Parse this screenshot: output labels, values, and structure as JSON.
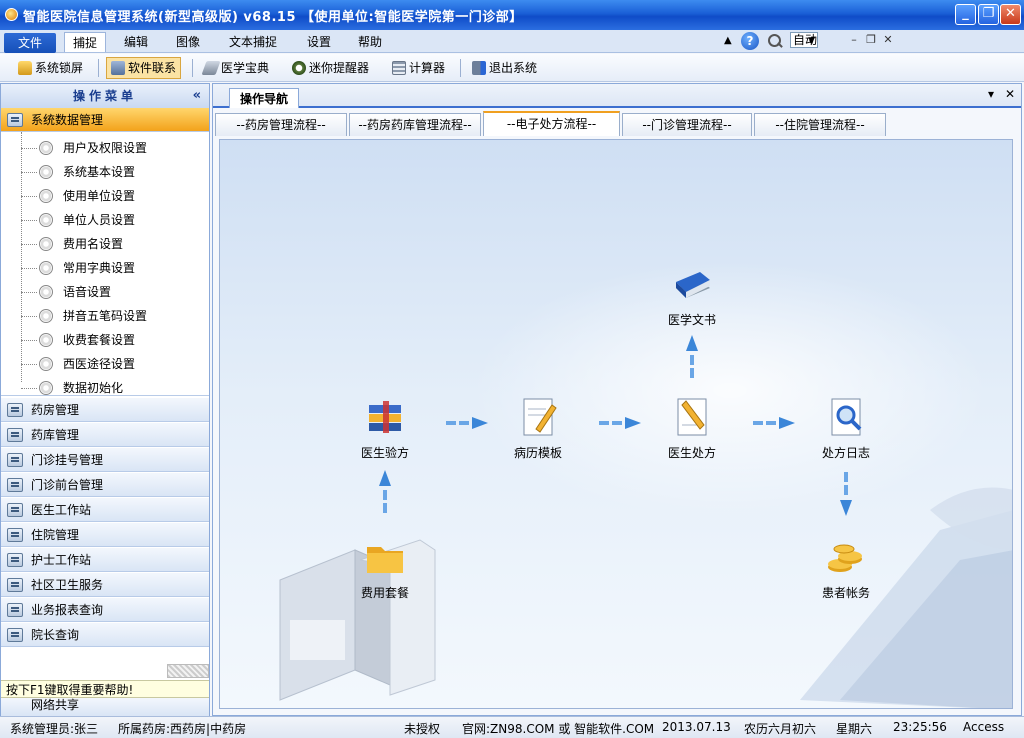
{
  "window": {
    "title": "智能医院信息管理系统(新型高级版) v68.15  【使用单位:智能医学院第一门诊部】"
  },
  "menu": {
    "items": [
      "文件",
      "捕捉",
      "编辑",
      "图像",
      "文本捕捉",
      "设置",
      "帮助"
    ],
    "active": "捕捉",
    "zoom_value": "自动"
  },
  "toolbar": {
    "items": [
      "系统锁屏",
      "软件联系",
      "医学宝典",
      "迷你提醒器",
      "计算器",
      "退出系统"
    ],
    "pressed": "软件联系"
  },
  "sidebar": {
    "title": "操作菜单",
    "expanded_group": "系统数据管理",
    "sub_items": [
      "用户及权限设置",
      "系统基本设置",
      "使用单位设置",
      "单位人员设置",
      "费用名设置",
      "常用字典设置",
      "语音设置",
      "拼音五笔码设置",
      "收费套餐设置",
      "西医途径设置",
      "数据初始化"
    ],
    "groups": [
      "药房管理",
      "药库管理",
      "门诊挂号管理",
      "门诊前台管理",
      "医生工作站",
      "住院管理",
      "护士工作站",
      "社区卫生服务",
      "业务报表查询",
      "院长查询"
    ],
    "hint": "按下F1键取得重要帮助!",
    "last_group": "网络共享"
  },
  "main": {
    "doc_tab": "操作导航",
    "flow_tabs": [
      "--药房管理流程--",
      "--药房药库管理流程--",
      "--电子处方流程--",
      "--门诊管理流程--",
      "--住院管理流程--"
    ],
    "active_flow_tab": "--电子处方流程--",
    "nodes": {
      "medical_book": "医学文书",
      "doctor_check": "医生验方",
      "record_template": "病历模板",
      "doctor_prescription": "医生处方",
      "prescription_log": "处方日志",
      "fee_package": "费用套餐",
      "patient_account": "患者帐务"
    }
  },
  "status": {
    "operator": "系统管理员:张三",
    "pharmacy": "所属药房:西药房|中药房",
    "license": "未授权",
    "website": "官网:ZN98.COM 或 智能软件.COM",
    "date": "2013.07.13",
    "lunar_date": "农历六月初六",
    "weekday": "星期六",
    "time": "23:25:56",
    "database": "Access"
  }
}
